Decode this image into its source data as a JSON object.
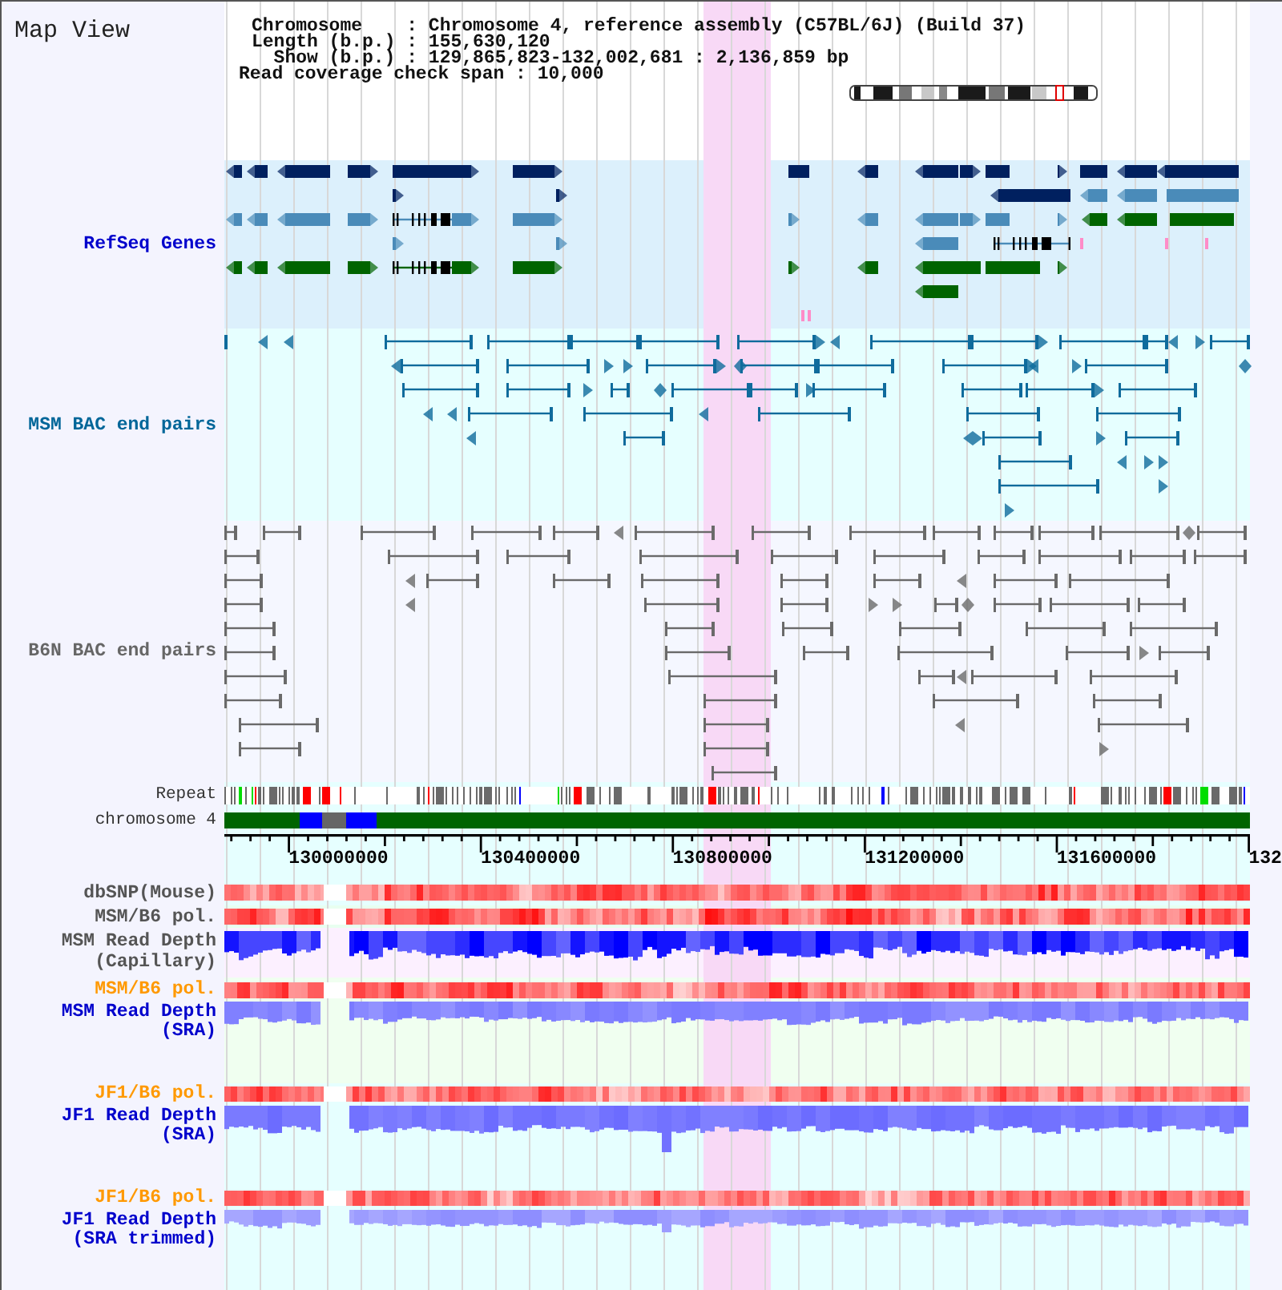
{
  "header": {
    "title": "Map View",
    "info": [
      {
        "label": "Chromosome",
        "value": ": Chromosome 4, reference assembly (C57BL/6J) (Build 37)"
      },
      {
        "label": "Length (b.p.)",
        "value": ": 155,630,120"
      },
      {
        "label": "Show (b.p.)",
        "value": ": 129,865,823-132,002,681 : 2,136,859 bp"
      }
    ],
    "coverage": {
      "label": "Read coverage check span",
      "value": ": 10,000"
    }
  },
  "tracks": [
    {
      "kind": "genes",
      "label": "RefSeq Genes",
      "color": "#0000cc"
    },
    {
      "kind": "bac",
      "label": "MSM BAC end pairs",
      "color": "#006699"
    },
    {
      "kind": "bac",
      "label": "B6N BAC end pairs",
      "color": "#666666"
    },
    {
      "kind": "repeat",
      "label": "Repeat",
      "color": "#333333"
    },
    {
      "kind": "chromosome",
      "label": "chromosome 4",
      "color": "#333333"
    },
    {
      "kind": "axis",
      "labels": [
        "130000000",
        "130400000",
        "130800000",
        "131200000",
        "131600000",
        "132"
      ]
    },
    {
      "kind": "snp",
      "label": "dbSNP(Mouse)",
      "color": "#555555"
    },
    {
      "kind": "snp",
      "label": "MSM/B6 pol.",
      "color": "#555555"
    },
    {
      "kind": "depth",
      "label": "MSM Read Depth (Capillary)",
      "color": "#555555"
    },
    {
      "kind": "snp",
      "label": "MSM/B6 pol.",
      "color": "#ff9900"
    },
    {
      "kind": "depth",
      "label": "MSM Read Depth (SRA)",
      "color": "#0000cc"
    },
    {
      "kind": "snp",
      "label": "JF1/B6 pol.",
      "color": "#ff9900"
    },
    {
      "kind": "depth",
      "label": "JF1 Read Depth (SRA)",
      "color": "#0000cc"
    },
    {
      "kind": "snp",
      "label": "JF1/B6 pol.",
      "color": "#ff9900"
    },
    {
      "kind": "depth",
      "label": "JF1 Read Depth (SRA trimmed)",
      "color": "#0000cc"
    }
  ]
}
